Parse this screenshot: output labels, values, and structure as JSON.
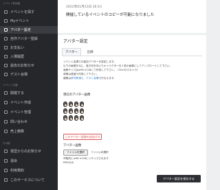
{
  "sidebar": {
    "sections": [
      {
        "label": "イベント参加者",
        "items": [
          {
            "label": "イベントを探す",
            "icon": "search-icon",
            "active": false
          },
          {
            "label": "Myイベント",
            "icon": "calendar-icon",
            "active": false
          },
          {
            "label": "アバター設定",
            "icon": "user-icon",
            "active": true
          },
          {
            "label": "自作アバター登録",
            "icon": "upload-icon",
            "active": false
          },
          {
            "label": "お支払い",
            "icon": "card-icon",
            "active": false
          },
          {
            "label": "入場履歴",
            "icon": "history-icon",
            "active": false
          },
          {
            "label": "過去のお知らせ",
            "icon": "bell-icon",
            "active": false
          },
          {
            "label": "デスト会場",
            "icon": "test-icon",
            "active": false
          }
        ]
      },
      {
        "label": "イベント主催",
        "items": [
          {
            "label": "開催する",
            "icon": "plus-icon",
            "active": false
          },
          {
            "label": "イベント作成",
            "icon": "edit-icon",
            "active": false
          },
          {
            "label": "イベント管理",
            "icon": "list-icon",
            "active": false
          },
          {
            "label": "問い合わせ",
            "icon": "mail-icon",
            "active": false
          },
          {
            "label": "売上精算",
            "icon": "yen-icon",
            "active": false
          }
        ]
      },
      {
        "label": "その他",
        "items": [
          {
            "label": "運営からのお知らせ",
            "icon": "info-icon",
            "active": false
          },
          {
            "label": "退会",
            "icon": "exit-icon",
            "active": false
          },
          {
            "label": "利用規約",
            "icon": "document-icon",
            "active": false
          },
          {
            "label": "このサービスについて",
            "icon": "help-icon",
            "active": false
          }
        ]
      }
    ]
  },
  "topbar": {
    "timestamp": "2022年01月21日 16:53",
    "notice": "開催しているイベントのコピーが可能になりました"
  },
  "avatar_settings": {
    "title": "アバター設定",
    "tabs": [
      {
        "label": "アバター",
        "active": true
      },
      {
        "label": "出欄",
        "active": false
      }
    ],
    "description": {
      "line1": "イベント会場での独自アバターを設定します。",
      "line2": "以下の画像を元に、各方向を向いたキャラクターを１枚の画像にしてアップロードして下さい。",
      "line3": "画像サイズはw96 h128にて作成して下さい。（32x32でキャラ）",
      "line4": "背景は透過で作成して下さい。",
      "line5_prefix": "建築は",
      "line5_link1": "許可条項",
      "line5_mid": "と、",
      "line5_link2": "デスト会場",
      "line5_suffix": "で行なえます。"
    },
    "current_avatar_title": "現在のアバター画像",
    "add_avatar_button": "このアバター画像を追加する",
    "avatar_image_title": "アバター画像",
    "file_button": "ファイルを選択",
    "file_status": "ファイル未選択",
    "note_line1": "市販的にw96 h128にリサイズされます",
    "note_line2": "PNGのみ",
    "save_button": "アバター設定を保存する"
  }
}
